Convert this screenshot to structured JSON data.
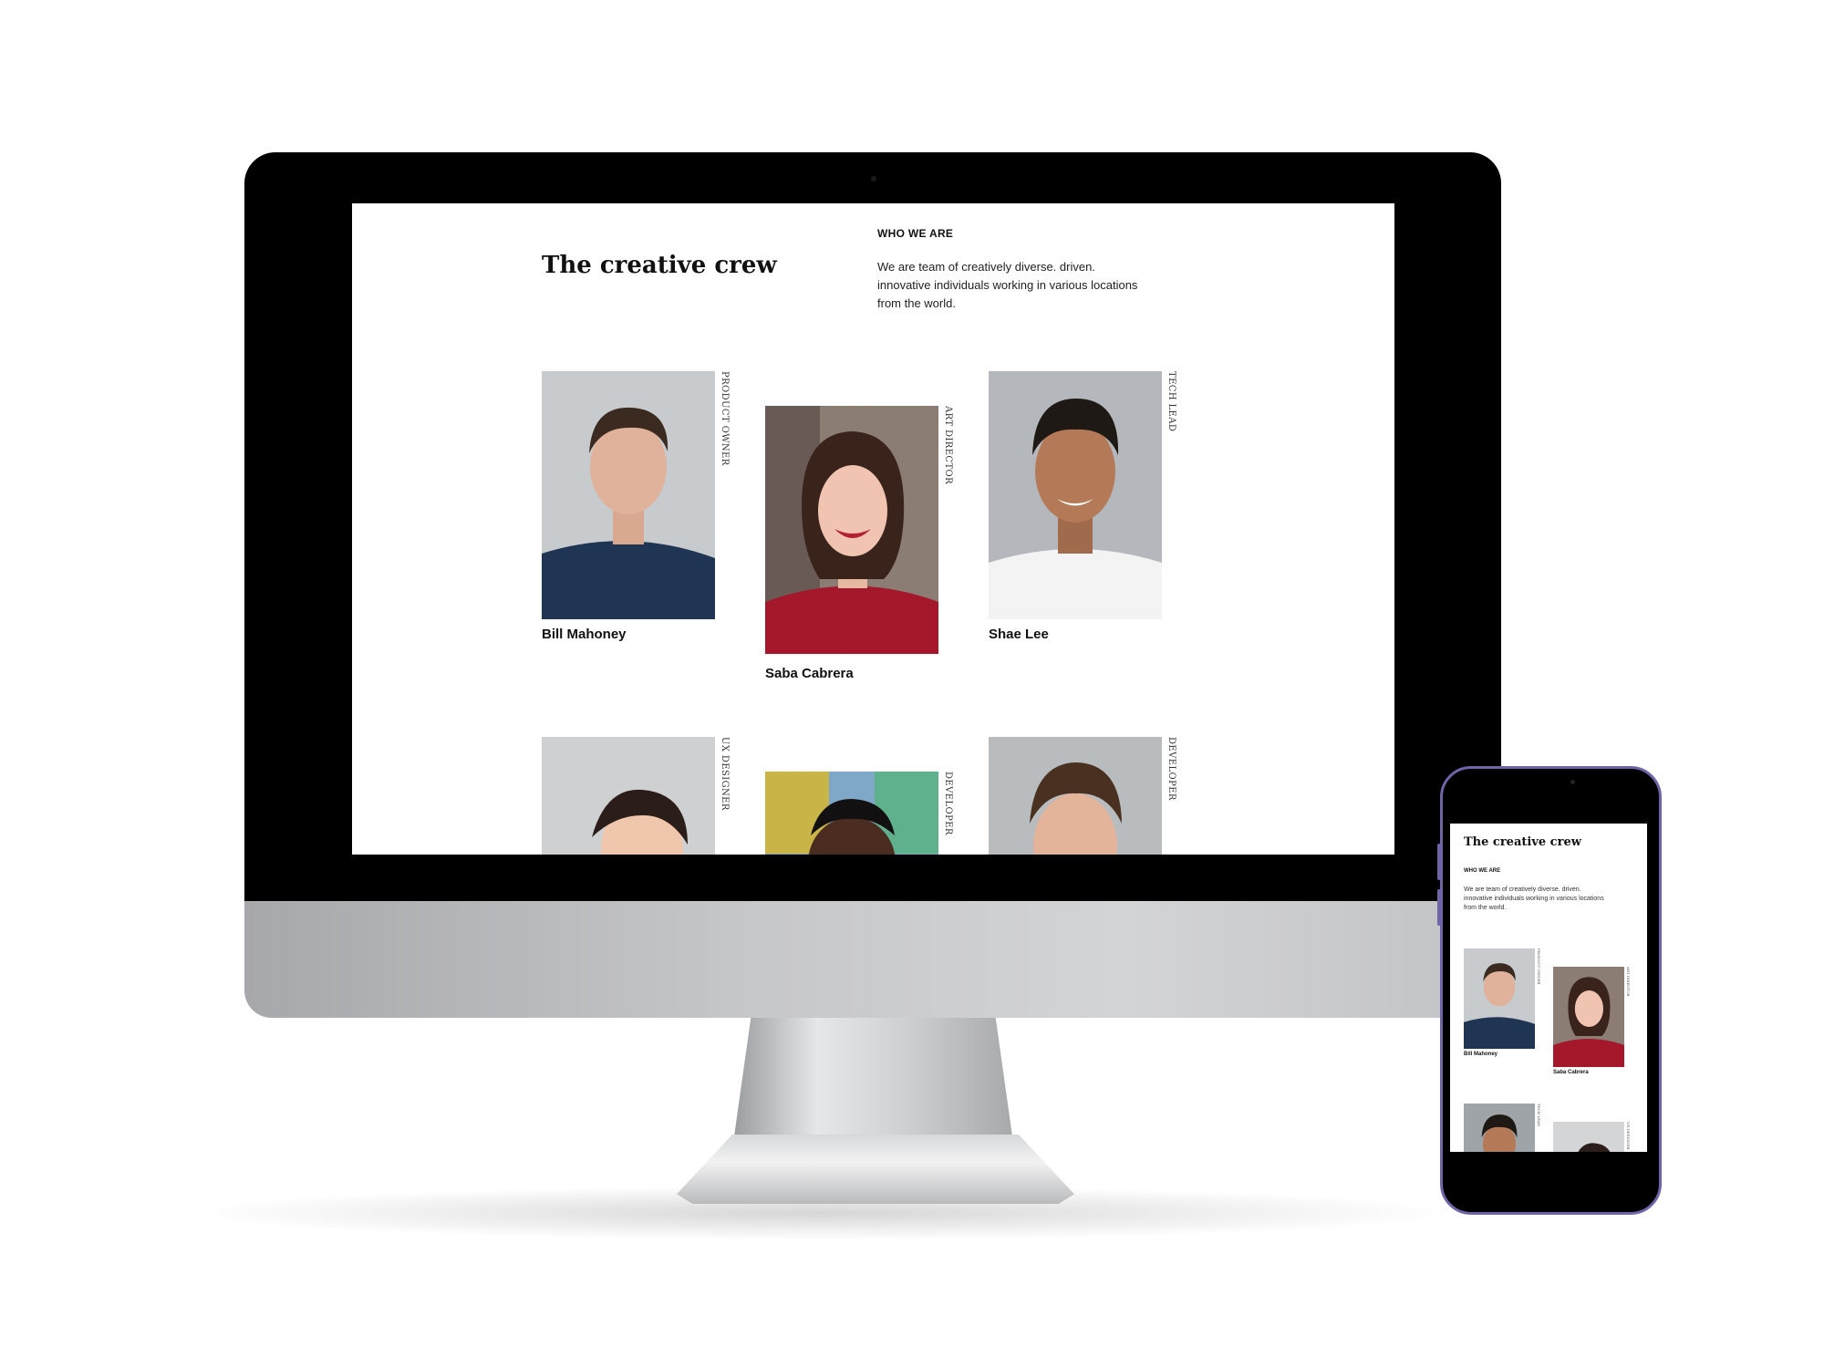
{
  "desktop": {
    "heading": "The creative crew",
    "eyebrow": "WHO WE ARE",
    "description": "We are team of creatively diverse. driven. innovative individuals working in various locations from the world.",
    "members": [
      {
        "name": "Bill Mahoney",
        "role": "PRODUCT OWNER"
      },
      {
        "name": "Saba Cabrera",
        "role": "ART DIRECTOR"
      },
      {
        "name": "Shae Lee",
        "role": "TECH LEAD"
      },
      {
        "name": "",
        "role": "UX DESIGNER"
      },
      {
        "name": "",
        "role": "DEVELOPER"
      },
      {
        "name": "",
        "role": "DEVELOPER"
      }
    ]
  },
  "mobile": {
    "heading": "The creative crew",
    "eyebrow": "WHO WE ARE",
    "description": "We are team of creatively diverse. driven. innovative individuals working in various locations from the world.",
    "members": [
      {
        "name": "Bill Mahoney",
        "role": "PRODUCT OWNER"
      },
      {
        "name": "Saba Cabrera",
        "role": "ART DIRECTOR"
      },
      {
        "name": "",
        "role": "TECH LEAD"
      },
      {
        "name": "",
        "role": "UX DESIGNER"
      }
    ]
  },
  "colors": {
    "bezel": "#000000",
    "phone_frame": "#6e64a6",
    "screen_bg": "#ffffff"
  }
}
